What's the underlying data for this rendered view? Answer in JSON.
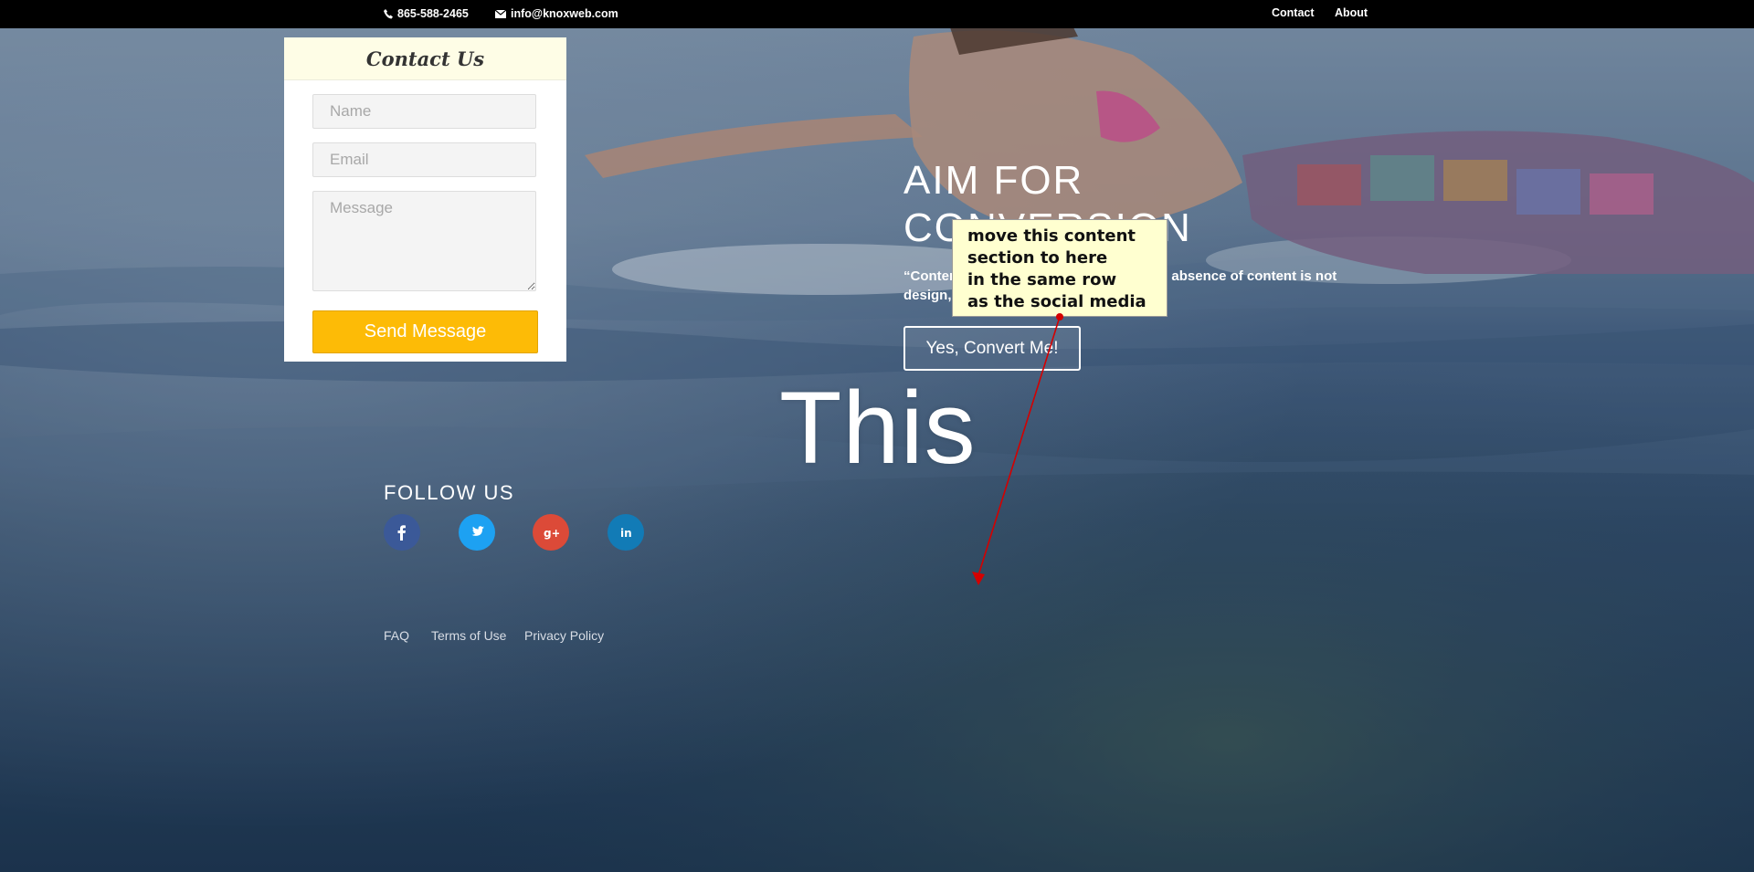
{
  "topbar": {
    "phone": "865-588-2465",
    "email": "info@knoxweb.com",
    "nav": {
      "contact": "Contact",
      "about": "About"
    }
  },
  "contact_form": {
    "title": "Contact Us",
    "name_placeholder": "Name",
    "email_placeholder": "Email",
    "message_placeholder": "Message",
    "submit_label": "Send Message"
  },
  "hero": {
    "title": "AIM FOR CONVERSION",
    "quote": "“Content precedes design. Design in the absence of content is not design, it’s decoration.”",
    "cta_label": "Yes, Convert Me!",
    "big_word": "This"
  },
  "social": {
    "title": "FOLLOW US",
    "networks": [
      {
        "name": "facebook",
        "icon": "facebook-icon",
        "color": "#3b5998"
      },
      {
        "name": "twitter",
        "icon": "twitter-icon",
        "color": "#1da1f2"
      },
      {
        "name": "google-plus",
        "icon": "google-plus-icon",
        "color": "#dc4a38"
      },
      {
        "name": "linkedin",
        "icon": "linkedin-icon",
        "color": "#127bb6"
      }
    ]
  },
  "footer": {
    "links": [
      "FAQ",
      "Terms of Use",
      "Privacy Policy"
    ]
  },
  "annotation": {
    "lines": [
      "move this content",
      "section to here",
      "in the same row",
      "as the social media"
    ]
  },
  "colors": {
    "accent": "#fdbb06",
    "topbar": "#000000",
    "annotation_bg": "#ffffd0",
    "arrow": "#d40000"
  }
}
